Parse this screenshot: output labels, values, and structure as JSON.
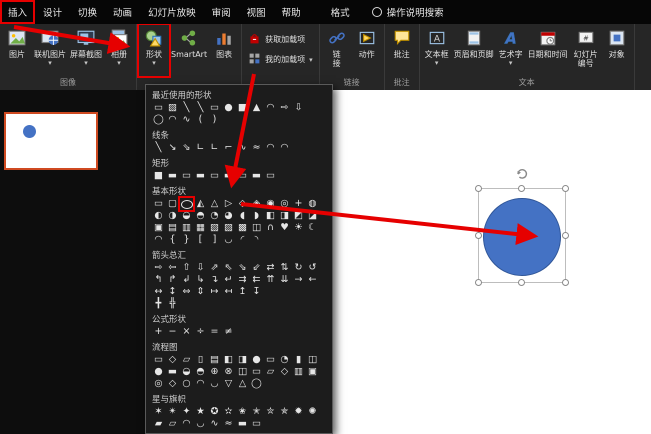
{
  "colors": {
    "annotation_red": "#e60000",
    "shape_blue": "#4472c4",
    "shape_blue_border": "#2f5597",
    "thumbnail_selected_border": "#cf4a21"
  },
  "menu": {
    "search_label": "操作说明搜索",
    "tabs": [
      {
        "label": "插入",
        "active": true,
        "boxed": true
      },
      {
        "label": "设计"
      },
      {
        "label": "切换"
      },
      {
        "label": "动画"
      },
      {
        "label": "幻灯片放映"
      },
      {
        "label": "审阅"
      },
      {
        "label": "视图"
      },
      {
        "label": "帮助"
      },
      {
        "label": "格式",
        "contextual": true
      }
    ]
  },
  "ribbon": {
    "groups": [
      {
        "label": "图像",
        "items": [
          {
            "label": "图片",
            "icon": "picture-icon",
            "en": "picture"
          },
          {
            "label": "联机图片",
            "icon": "online-pictures-icon",
            "en": "online-pictures",
            "dropdown": true
          },
          {
            "label": "屏幕截图",
            "icon": "screenshot-icon",
            "en": "screenshot",
            "dropdown": true
          },
          {
            "label": "相册",
            "icon": "photo-album-icon",
            "en": "photo-album",
            "dropdown": true
          }
        ]
      },
      {
        "label": "",
        "items": [
          {
            "label": "形状",
            "icon": "shapes-icon",
            "en": "shapes",
            "dropdown": true,
            "boxed": true
          },
          {
            "label": "SmartArt",
            "icon": "smartart-icon",
            "en": "smartart"
          },
          {
            "label": "图表",
            "icon": "chart-icon",
            "en": "chart"
          }
        ]
      },
      {
        "label": "",
        "stack": true,
        "items": [
          {
            "label": "获取加载项",
            "icon": "get-addins-icon",
            "en": "get-addins"
          },
          {
            "label": "我的加载项",
            "icon": "my-addins-icon",
            "en": "my-addins",
            "dropdown": true
          }
        ]
      },
      {
        "label": "链接",
        "items": [
          {
            "label": "链接",
            "icon": "link-icon",
            "en": "link",
            "w": 14
          },
          {
            "label": "动作",
            "icon": "action-icon",
            "en": "action"
          }
        ]
      },
      {
        "label": "批注",
        "items": [
          {
            "label": "批注",
            "icon": "comment-icon",
            "en": "comment"
          }
        ]
      },
      {
        "label": "文本",
        "items": [
          {
            "label": "文本框",
            "icon": "textbox-icon",
            "en": "textbox",
            "dropdown": true
          },
          {
            "label": "页眉和页脚",
            "icon": "header-footer-icon",
            "en": "header-footer"
          },
          {
            "label": "艺术字",
            "icon": "wordart-icon",
            "en": "wordart",
            "dropdown": true
          },
          {
            "label": "日期和时间",
            "icon": "datetime-icon",
            "en": "datetime"
          },
          {
            "label": "幻灯片编号",
            "icon": "slidenumber-icon",
            "en": "slide-number",
            "w": 28
          },
          {
            "label": "对象",
            "icon": "object-icon",
            "en": "object"
          }
        ]
      }
    ]
  },
  "shapes_panel": {
    "highlight": {
      "section": 3,
      "row": 0,
      "col": 2
    },
    "sections": [
      {
        "title": "最近使用的形状",
        "rows": [
          [
            "▭",
            "▨",
            "╲",
            "╲",
            "▭",
            "●",
            "■",
            "▲",
            "◠",
            "⇨",
            "⇩"
          ],
          [
            "◯",
            "◠",
            "∿",
            "(",
            ")"
          ]
        ]
      },
      {
        "title": "线条",
        "rows": [
          [
            "╲",
            "↘",
            "⇘",
            "∟",
            "∟",
            "⌐",
            "∿",
            "≈",
            "◠",
            "◠"
          ]
        ]
      },
      {
        "title": "矩形",
        "rows": [
          [
            "■",
            "▬",
            "▭",
            "▬",
            "▭",
            "▬",
            "▭",
            "▬",
            "▭"
          ]
        ]
      },
      {
        "title": "基本形状",
        "rows": [
          [
            "▭",
            "▢",
            "OVAL",
            "◭",
            "△",
            "▷",
            "◇",
            "◈",
            "◉",
            "◎",
            "+",
            "◍"
          ],
          [
            "◐",
            "◑",
            "◒",
            "◓",
            "◔",
            "◕",
            "◖",
            "◗",
            "◧",
            "◨",
            "◩",
            "◪"
          ],
          [
            "▣",
            "▤",
            "▥",
            "▦",
            "▧",
            "▨",
            "▩",
            "◫",
            "∩",
            "♥",
            "☀",
            "☾"
          ],
          [
            "◠",
            "{",
            "}",
            "[",
            "]",
            "◡",
            "◜",
            "◝"
          ]
        ]
      },
      {
        "title": "箭头总汇",
        "rows": [
          [
            "⇨",
            "⇦",
            "⇧",
            "⇩",
            "⇗",
            "⇖",
            "⇘",
            "⇙",
            "⇄",
            "⇅",
            "↻",
            "↺"
          ],
          [
            "↰",
            "↱",
            "↲",
            "↳",
            "↴",
            "↵",
            "⇉",
            "⇇",
            "⇈",
            "⇊",
            "→",
            "←"
          ],
          [
            "↔",
            "↕",
            "⇔",
            "⇕",
            "↦",
            "↤",
            "↥",
            "↧"
          ],
          [
            "╋",
            "╬"
          ]
        ]
      },
      {
        "title": "公式形状",
        "rows": [
          [
            "+",
            "−",
            "×",
            "÷",
            "=",
            "≠"
          ]
        ]
      },
      {
        "title": "流程图",
        "rows": [
          [
            "▭",
            "◇",
            "▱",
            "▯",
            "▤",
            "◧",
            "◨",
            "●",
            "▭",
            "◔",
            "▮",
            "◫"
          ],
          [
            "●",
            "▬",
            "◒",
            "◓",
            "⊕",
            "⊗",
            "◫",
            "▭",
            "▱",
            "◇",
            "▥",
            "▣"
          ],
          [
            "◎",
            "◇",
            "○",
            "◠",
            "◡",
            "▽",
            "△",
            "◯"
          ]
        ]
      },
      {
        "title": "星与旗帜",
        "rows": [
          [
            "✶",
            "✴",
            "✦",
            "★",
            "✪",
            "✫",
            "✬",
            "✭",
            "✮",
            "✯",
            "✹",
            "✺"
          ],
          [
            "▰",
            "▱",
            "◠",
            "◡",
            "∿",
            "≈",
            "▬",
            "▭"
          ]
        ]
      }
    ]
  },
  "slide_panel": {
    "thumbnail": {
      "shape": "circle",
      "fill": "#4472c4",
      "selected": true
    }
  },
  "canvas": {
    "shape": {
      "type": "oval",
      "fill": "#4472c4",
      "selected": true
    }
  }
}
